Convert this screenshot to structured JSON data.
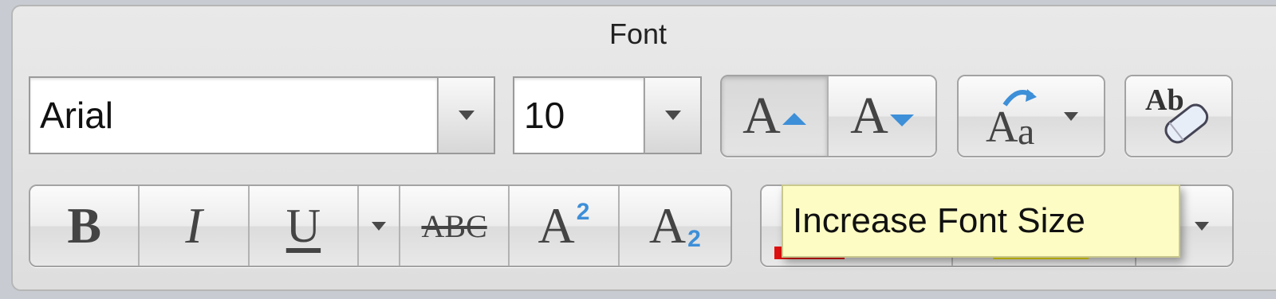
{
  "group": {
    "title": "Font"
  },
  "font_name": {
    "value": "Arial"
  },
  "font_size": {
    "value": "10"
  },
  "size_buttons": {
    "increase_glyph": "A",
    "decrease_glyph": "A"
  },
  "change_case": {
    "glyph_upper": "A",
    "glyph_lower": "a"
  },
  "clear_formatting": {
    "glyph": "Ab"
  },
  "style_buttons": {
    "bold": "B",
    "italic": "I",
    "underline": "U",
    "strikethrough": "ABC",
    "superscript_base": "A",
    "superscript_num": "2",
    "subscript_base": "A",
    "subscript_num": "2"
  },
  "tooltip": {
    "text": "Increase Font Size"
  },
  "colors": {
    "accent_blue": "#3d8fd8",
    "highlight_swatch": "#f2e600",
    "font_color_swatch": "#e01010",
    "tooltip_bg": "#fdfcc4"
  }
}
